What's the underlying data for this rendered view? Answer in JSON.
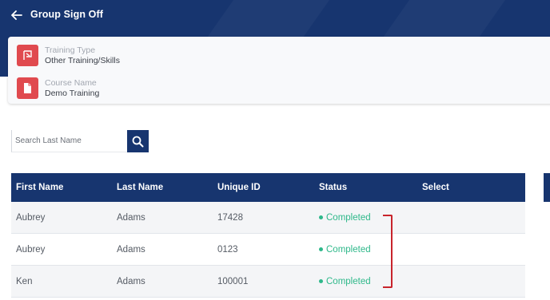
{
  "header": {
    "title": "Group Sign Off"
  },
  "info": {
    "training_type": {
      "label": "Training Type",
      "value": "Other Training/Skills"
    },
    "course": {
      "label": "Course Name",
      "value": "Demo Training"
    }
  },
  "search": {
    "placeholder": "Search Last Name",
    "value": ""
  },
  "table": {
    "headers": {
      "first_name": "First Name",
      "last_name": "Last Name",
      "unique_id": "Unique ID",
      "status": "Status",
      "select": "Select"
    },
    "rows": [
      {
        "first_name": "Aubrey",
        "last_name": "Adams",
        "unique_id": "17428",
        "status": "Completed"
      },
      {
        "first_name": "Aubrey",
        "last_name": "Adams",
        "unique_id": "0123",
        "status": "Completed"
      },
      {
        "first_name": "Ken",
        "last_name": "Adams",
        "unique_id": "100001",
        "status": "Completed"
      }
    ]
  },
  "colors": {
    "navy": "#17356f",
    "icon_red": "#e04a4f",
    "status_green": "#2eb88a",
    "annotation_red": "#c8242c"
  }
}
